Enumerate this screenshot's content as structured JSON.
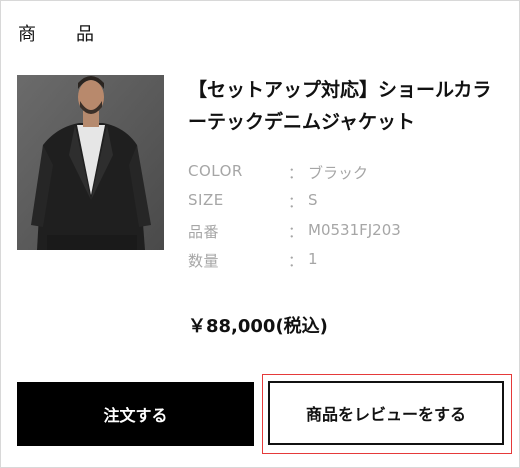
{
  "section": {
    "title_c1": "商",
    "title_c2": "品"
  },
  "product": {
    "name": "【セットアップ対応】ショールカラーテックデニムジャケット",
    "image_alt": "product-photo"
  },
  "specs": [
    {
      "label": "COLOR",
      "colon": "：",
      "value": "ブラック"
    },
    {
      "label": "SIZE",
      "colon": "：",
      "value": "S"
    },
    {
      "label": "品番",
      "colon": "：",
      "value": "M0531FJ203"
    },
    {
      "label": "数量",
      "colon": "：",
      "value": "1"
    }
  ],
  "price": "￥88,000(税込)",
  "buttons": {
    "order": "注文する",
    "review": "商品をレビューをする"
  },
  "colors": {
    "order_bg": "#000000",
    "highlight": "#e53a3a",
    "muted_text": "#a6a6a6"
  }
}
